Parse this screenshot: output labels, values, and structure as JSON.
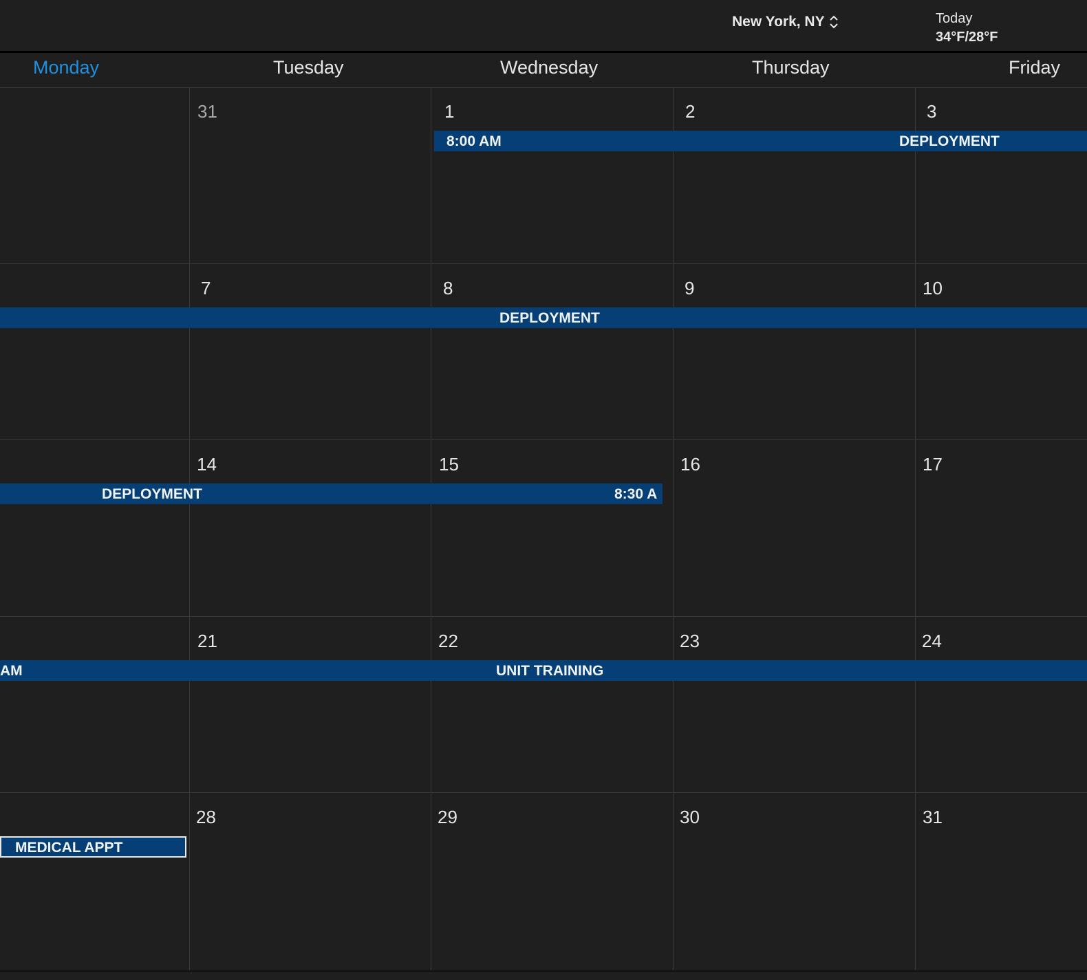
{
  "header": {
    "location": "New York, NY",
    "weather_label": "Today",
    "weather_temp": "34°F/28°F"
  },
  "days": [
    "Monday",
    "Tuesday",
    "Wednesday",
    "Thursday",
    "Friday"
  ],
  "current_day": "Monday",
  "weeks": [
    [
      "",
      "31",
      "1",
      "2",
      "3"
    ],
    [
      "",
      "7",
      "8",
      "9",
      "10"
    ],
    [
      "",
      "14",
      "15",
      "16",
      "17"
    ],
    [
      "",
      "21",
      "22",
      "23",
      "24"
    ],
    [
      "",
      "28",
      "29",
      "30",
      "31"
    ]
  ],
  "events": {
    "w1_time": "8:00 AM",
    "w1_title": "DEPLOYMENT",
    "w2_title": "DEPLOYMENT",
    "w3_title": "DEPLOYMENT",
    "w3_time": "8:30 A",
    "w4_time": "AM",
    "w4_title": "UNIT TRAINING",
    "w5_title": "MEDICAL APPT"
  },
  "colors": {
    "background": "#1f1f1f",
    "event": "#053f76",
    "accent": "#1f8fe0",
    "gridline": "#3a3a3a"
  }
}
